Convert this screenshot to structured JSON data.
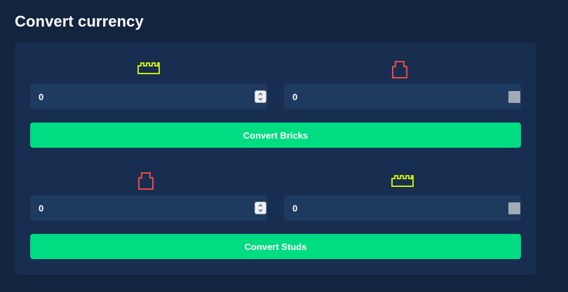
{
  "page": {
    "title": "Convert currency"
  },
  "colors": {
    "background": "#13243f",
    "panel": "#182e50",
    "field": "#1f3a5f",
    "accent_green": "#00dc82",
    "stud_icon": "#c4e80c",
    "brick_icon": "#ea4a44"
  },
  "converters": {
    "bricks": {
      "from_icon": "stud-icon",
      "to_icon": "brick-icon",
      "input_value": "0",
      "output_value": "0",
      "button_label": "Convert Bricks"
    },
    "studs": {
      "from_icon": "brick-icon",
      "to_icon": "stud-icon",
      "input_value": "0",
      "output_value": "0",
      "button_label": "Convert Studs"
    }
  }
}
